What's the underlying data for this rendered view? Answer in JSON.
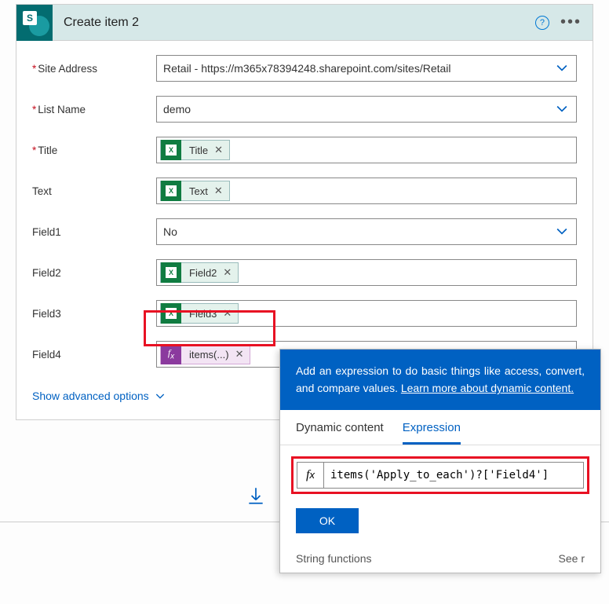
{
  "header": {
    "app_badge": "S",
    "title": "Create item 2"
  },
  "fields": {
    "site_address": {
      "label": "Site Address",
      "value": "Retail - https://m365x78394248.sharepoint.com/sites/Retail"
    },
    "list_name": {
      "label": "List Name",
      "value": "demo"
    },
    "title": {
      "label": "Title",
      "token": "Title"
    },
    "text": {
      "label": "Text",
      "token": "Text"
    },
    "field1": {
      "label": "Field1",
      "value": "No"
    },
    "field2": {
      "label": "Field2",
      "token": "Field2"
    },
    "field3": {
      "label": "Field3",
      "token": "Field3"
    },
    "field4": {
      "label": "Field4",
      "token": "items(...)"
    }
  },
  "advanced_label": "Show advanced options",
  "popup": {
    "intro_prefix": "Add an expression to do basic things like access, convert, and compare values. ",
    "intro_link": "Learn more about dynamic content.",
    "tab_dynamic": "Dynamic content",
    "tab_expression": "Expression",
    "expression": "items('Apply_to_each')?['Field4']",
    "ok": "OK",
    "fn_group": "String functions",
    "see_more": "See r"
  }
}
